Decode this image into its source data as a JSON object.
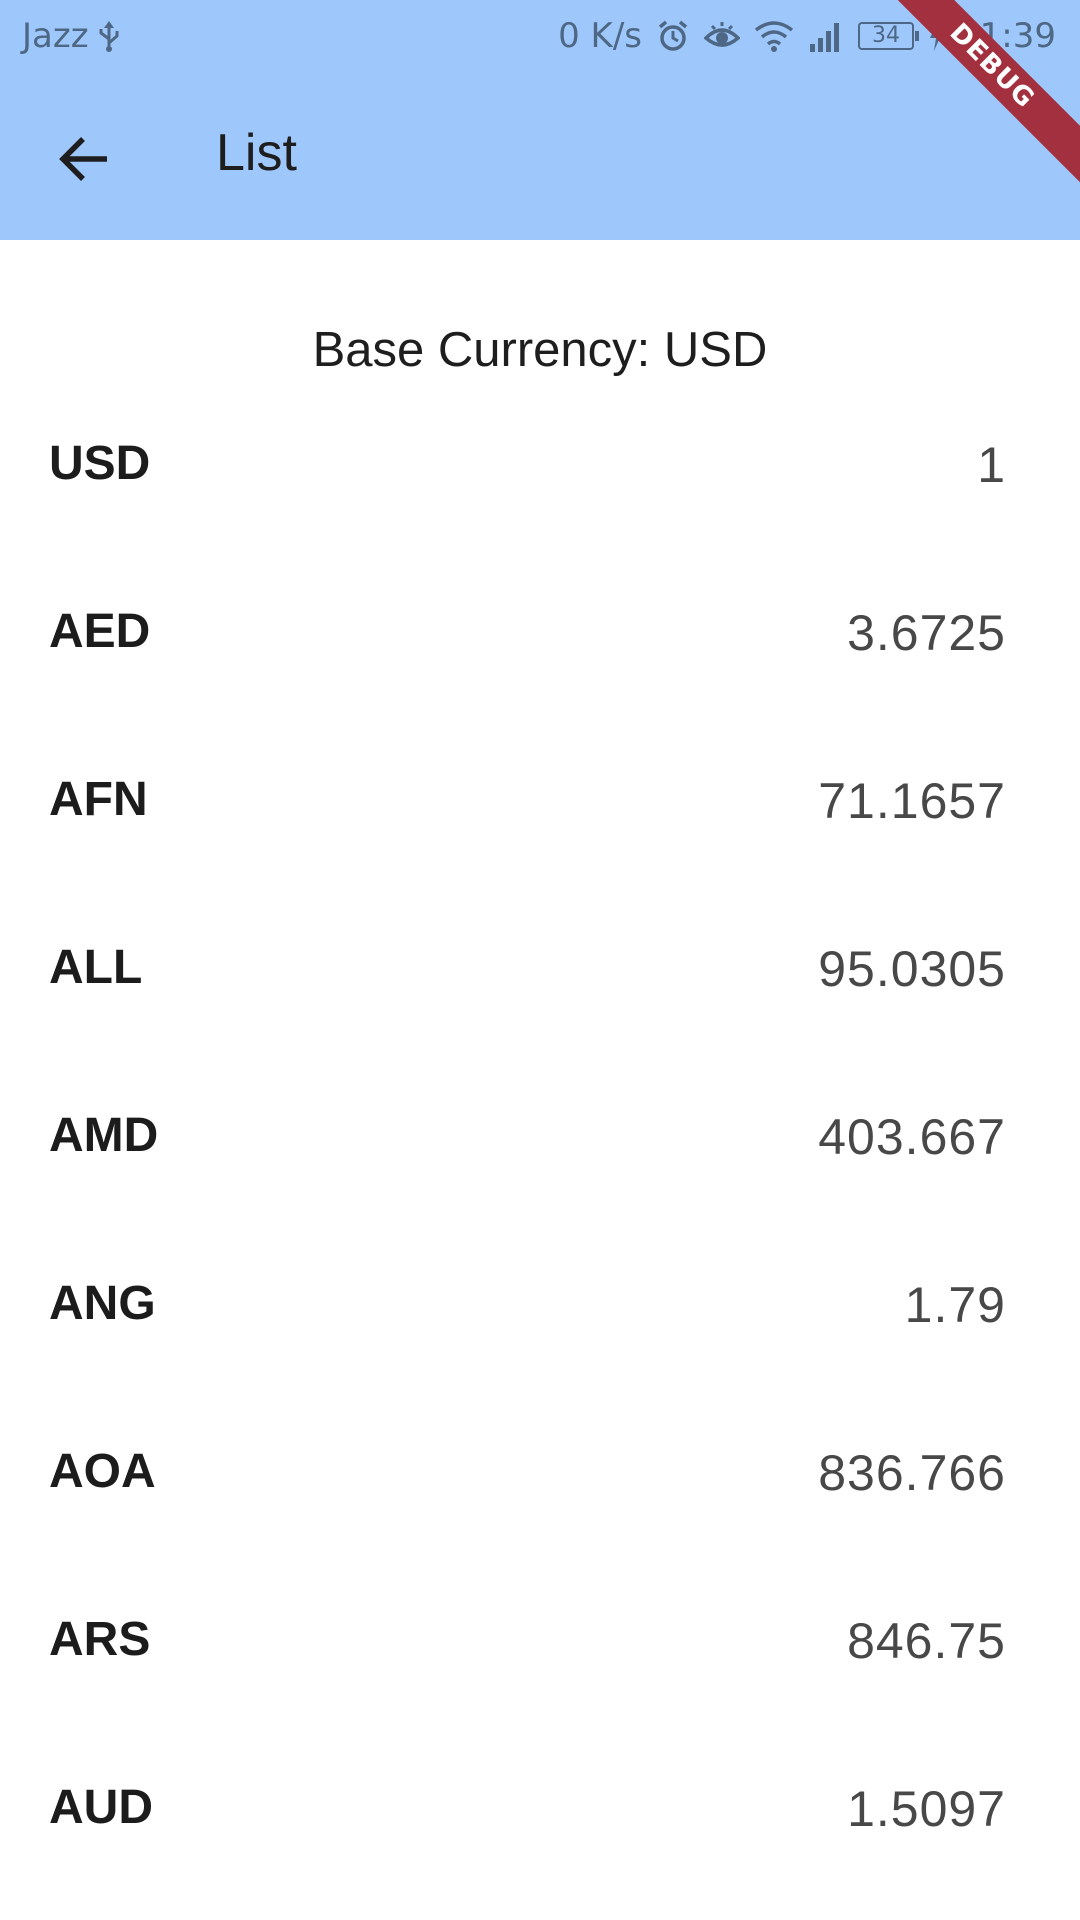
{
  "status_bar": {
    "carrier": "Jazz",
    "network_speed": "0 K/s",
    "battery_level": "34",
    "time": "11:39",
    "icons": [
      "usb-icon",
      "alarm-icon",
      "eye-icon",
      "wifi-icon",
      "signal-icon",
      "battery-icon",
      "charging-icon"
    ]
  },
  "app_bar": {
    "title": "List",
    "back_icon": "arrow-back-icon",
    "background_color": "#9ec8fc",
    "debug_banner": "DEBUG",
    "debug_banner_color": "#a3303e"
  },
  "content": {
    "base_currency_label": "Base Currency: USD",
    "rates": [
      {
        "code": "USD",
        "value": "1"
      },
      {
        "code": "AED",
        "value": "3.6725"
      },
      {
        "code": "AFN",
        "value": "71.1657"
      },
      {
        "code": "ALL",
        "value": "95.0305"
      },
      {
        "code": "AMD",
        "value": "403.667"
      },
      {
        "code": "ANG",
        "value": "1.79"
      },
      {
        "code": "AOA",
        "value": "836.766"
      },
      {
        "code": "ARS",
        "value": "846.75"
      },
      {
        "code": "AUD",
        "value": "1.5097"
      }
    ]
  }
}
